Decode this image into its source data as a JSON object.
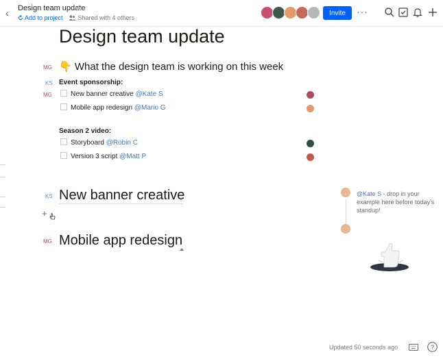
{
  "header": {
    "back_glyph": "‹",
    "doc_title": "Design team update",
    "star_glyph": "★",
    "add_to_project": "Add to project",
    "shared": "Shared with 4 others",
    "invite_label": "Invite",
    "more_glyph": "···",
    "avatar_colors": [
      "#c8506e",
      "#3a5a4c",
      "#e39a68",
      "#c46a5a",
      "#b7b7b7"
    ]
  },
  "document": {
    "title": "Design team update",
    "intro": {
      "author_initials": "MG",
      "emoji": "👇",
      "text": "What the design team is working on this week"
    },
    "sections": [
      {
        "author_initials": "KS",
        "label": "Event sponsorship:",
        "tasks": [
          {
            "author_initials": "MG",
            "text": "New banner creative",
            "mention": "@Kate S",
            "assignee_color": "#b04a62"
          },
          {
            "author_initials": "",
            "text": "Mobile app redesign",
            "mention": "@Mario G",
            "assignee_color": "#e39a68"
          }
        ]
      },
      {
        "author_initials": "",
        "label": "Season 2 video:",
        "tasks": [
          {
            "author_initials": "",
            "text": "Storyboard",
            "mention": "@Robin C",
            "assignee_color": "#2f4f40"
          },
          {
            "author_initials": "",
            "text": "Version 3 script",
            "mention": "@Matt P",
            "assignee_color": "#c25a4c"
          }
        ]
      }
    ],
    "heading_1": {
      "author_initials": "KS",
      "text": "New banner creative"
    },
    "heading_2": {
      "author_initials": "MG",
      "text": "Mobile app redesign"
    },
    "plus_glyph": "+"
  },
  "comment": {
    "mention": "@Kate S",
    "text": " - drop in your example here before today's standup!"
  },
  "footer": {
    "status": "Updated 50 seconds ago",
    "help_glyph": "?"
  },
  "colors": {
    "accent": "#0061fe",
    "mention": "#3a78c5"
  }
}
